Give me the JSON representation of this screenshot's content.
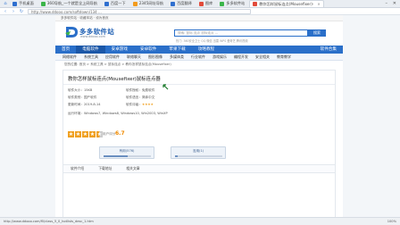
{
  "browser": {
    "tabs": [
      {
        "label": "手机桌面",
        "active": false
      },
      {
        "label": "360导航_一个就是全上网导航",
        "active": false
      },
      {
        "label": "百度一下",
        "active": false
      },
      {
        "label": "2345网址导航",
        "active": false
      },
      {
        "label": "百度翻译",
        "active": false
      },
      {
        "label": "图库",
        "active": false
      },
      {
        "label": "多多软件站",
        "active": false
      },
      {
        "label": "教你怎样鼠标连点(Mousefixer)-",
        "active": true
      }
    ],
    "url": "http://www.ddooo.com/softdown/134 ...",
    "status_url": "http://www.ddooo.com/fll/class_5_0_hotlists_desc_1.htm",
    "status_right": "100%"
  },
  "site": {
    "toplinks": "多多软件站 · 收藏本站 · 设为首页",
    "logo_text": "多多软件站",
    "logo_sub": "www.ddooo.com",
    "search_placeholder": "搜索: 鼠标 连点 鼠标连点 ...",
    "search_button": "搜索",
    "hot": "热门: 360安全卫士  QQ  微信  迅雷  WPS  爱奇艺  腾讯视频",
    "nav": [
      "首页",
      "电脑软件",
      "安卓游戏",
      "安卓软件",
      "苹果下载",
      "攻略教程"
    ],
    "nav_right": "软件合集",
    "nav_active_index": 1,
    "subnav": [
      "网络软件",
      "系统工具",
      "应用软件",
      "联络聊天",
      "图形图像",
      "多媒体类",
      "行业软件",
      "游戏娱乐",
      "编程开发",
      "安全相关",
      "教育教学",
      "手机相关"
    ],
    "breadcrumb": "您的位置: 首页 > 系统工具 > 鼠标连点 > 教你怎样鼠标连点(Mousefixer)",
    "title": "教你怎样鼠标连点(Mousefixer)鼠标连点器",
    "info": [
      {
        "k": "软件大小",
        "v": "15KB"
      },
      {
        "k": "软件类别",
        "v": "国产软件"
      },
      {
        "k": "更新时间",
        "v": "2019-8-14"
      },
      {
        "k": "软件授权",
        "v": "免费软件"
      },
      {
        "k": "软件语言",
        "v": "简体中文"
      },
      {
        "k": "软件评级",
        "v": "★★★★"
      },
      {
        "k": "运行环境",
        "v": "Windows7, Windows8, Windows10, Win2003, WinXP"
      }
    ],
    "rating_label": "用户评分",
    "rating_score": "6.7",
    "stars_full": 4,
    "stars_half": 1,
    "good_button": "有用(576)",
    "good_fraction": 0.5,
    "bad_button": "没用(1)",
    "bad_fraction": 0.05,
    "content_tabs": [
      "软件介绍",
      "下载地址",
      "相关文章"
    ]
  }
}
